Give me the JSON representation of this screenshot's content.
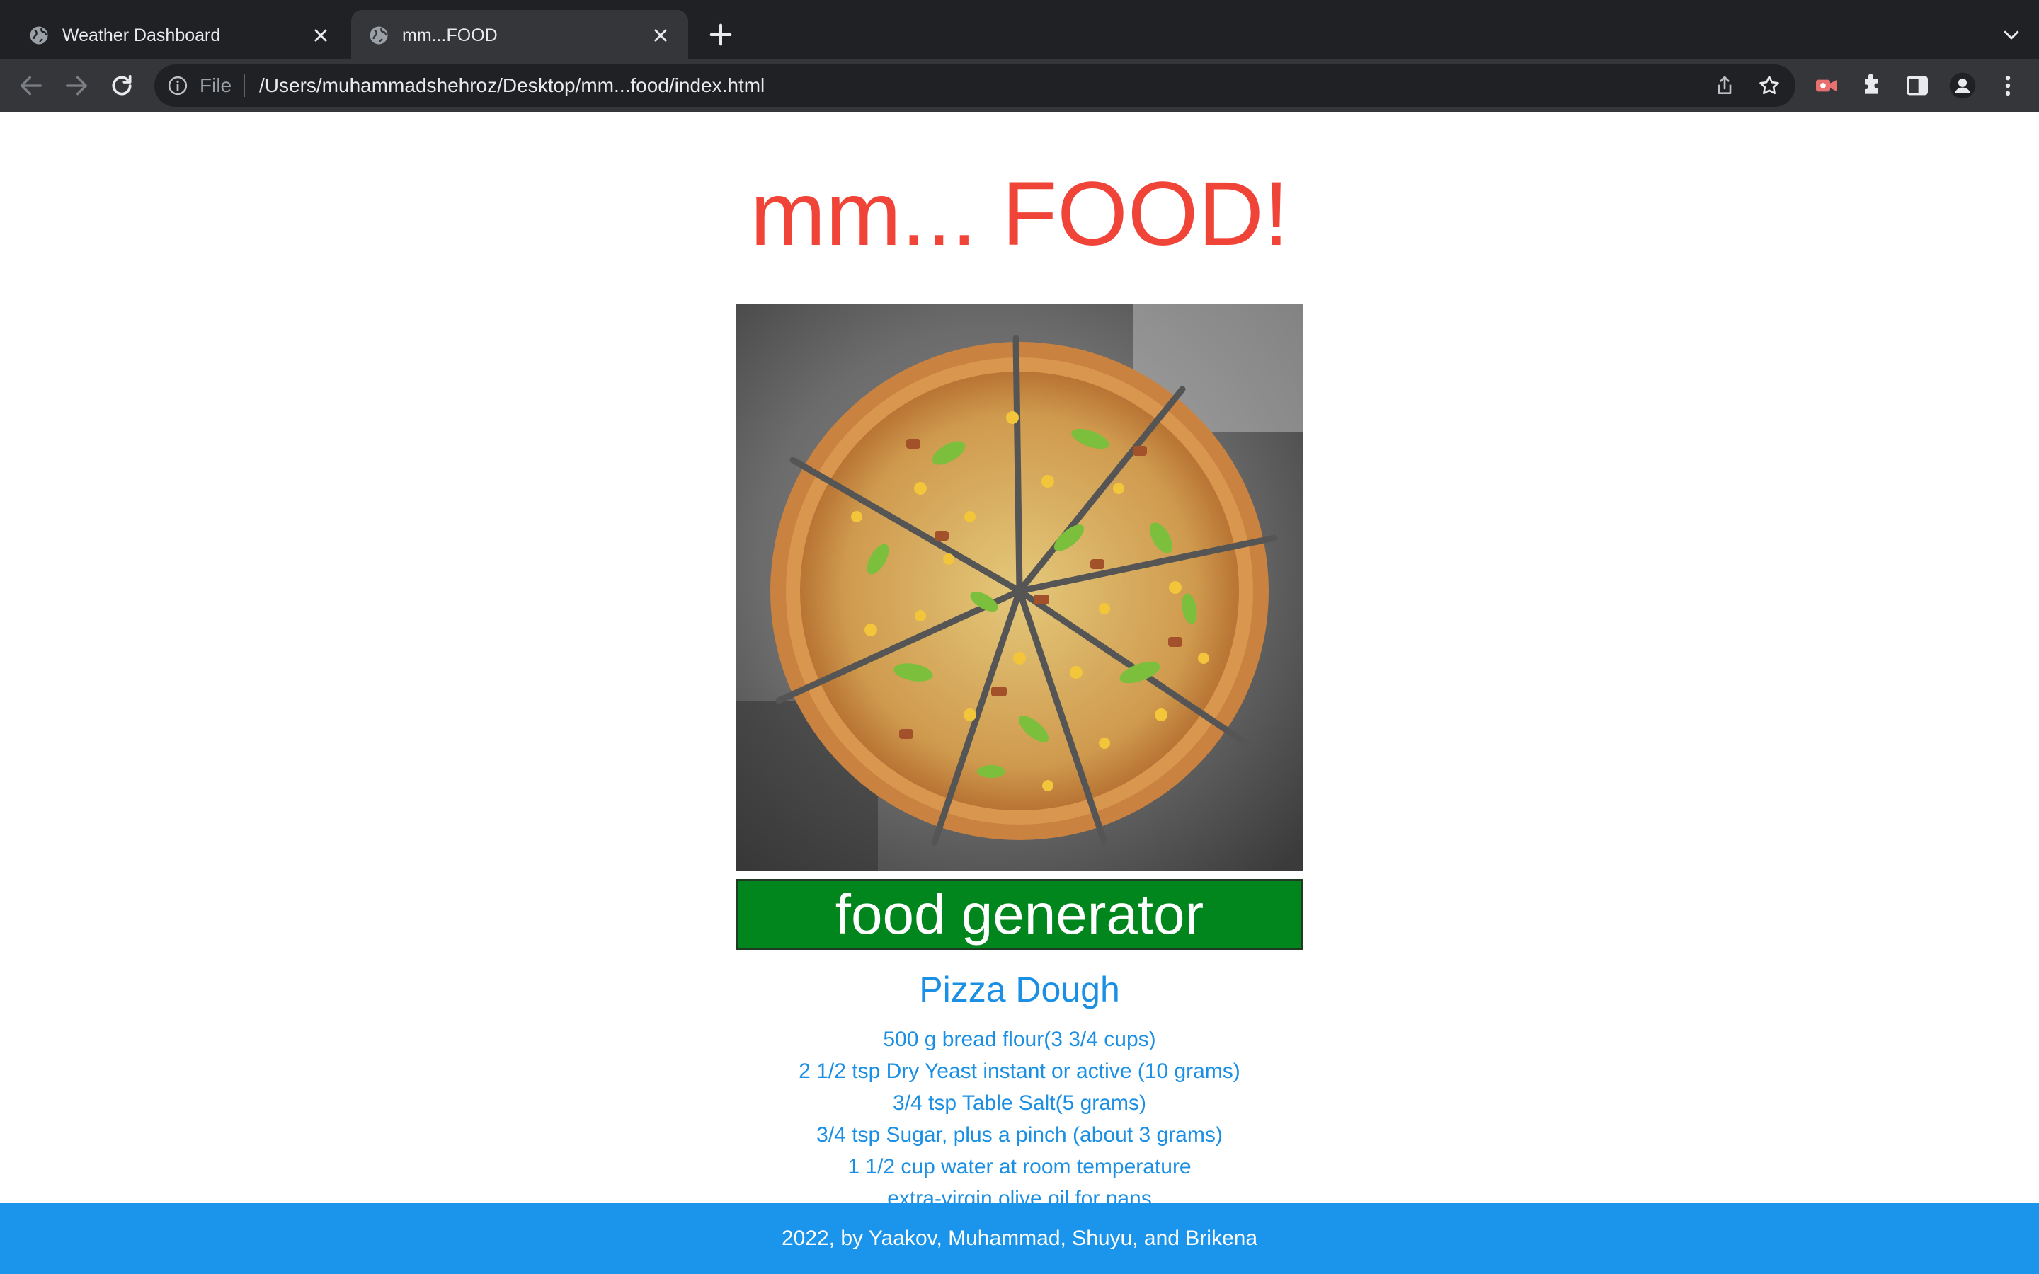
{
  "browser": {
    "tabs": [
      {
        "title": "Weather Dashboard",
        "active": false
      },
      {
        "title": "mm...FOOD",
        "active": true
      }
    ],
    "omnibox": {
      "scheme_label": "File",
      "url": "/Users/muhammadshehroz/Desktop/mm...food/index.html"
    },
    "icons": {
      "back": "back-arrow-icon",
      "forward": "forward-arrow-icon",
      "reload": "reload-icon",
      "info": "info-icon",
      "share": "share-icon",
      "bookmark": "star-icon",
      "extension_red": "recorder-extension-icon",
      "extensions": "puzzle-icon",
      "side_panel": "side-panel-icon",
      "profile": "profile-icon",
      "menu": "kebab-menu-icon"
    }
  },
  "page": {
    "heading": "mm... FOOD!",
    "image": {
      "subject": "pizza",
      "alt": "sliced pizza with corn, peppers and chicken"
    },
    "generator_button": "food generator",
    "recipe": {
      "title": "Pizza Dough",
      "ingredients": [
        "500 g bread flour(3 3/4 cups)",
        "2 1/2 tsp Dry Yeast instant or active (10 grams)",
        "3/4 tsp Table Salt(5 grams)",
        "3/4 tsp Sugar, plus a pinch (about 3 grams)",
        "1 1/2 cup water at room temperature",
        "extra-virgin olive oil for pans"
      ]
    },
    "footer": "2022, by Yaakov, Muhammad, Shuyu, and Brikena"
  },
  "colors": {
    "heading": "#f04438",
    "button_bg": "#00861c",
    "recipe_text": "#1a8fe3",
    "footer_bg": "#1a95eb",
    "chrome_dark": "#202124",
    "chrome_toolbar": "#35363a"
  }
}
